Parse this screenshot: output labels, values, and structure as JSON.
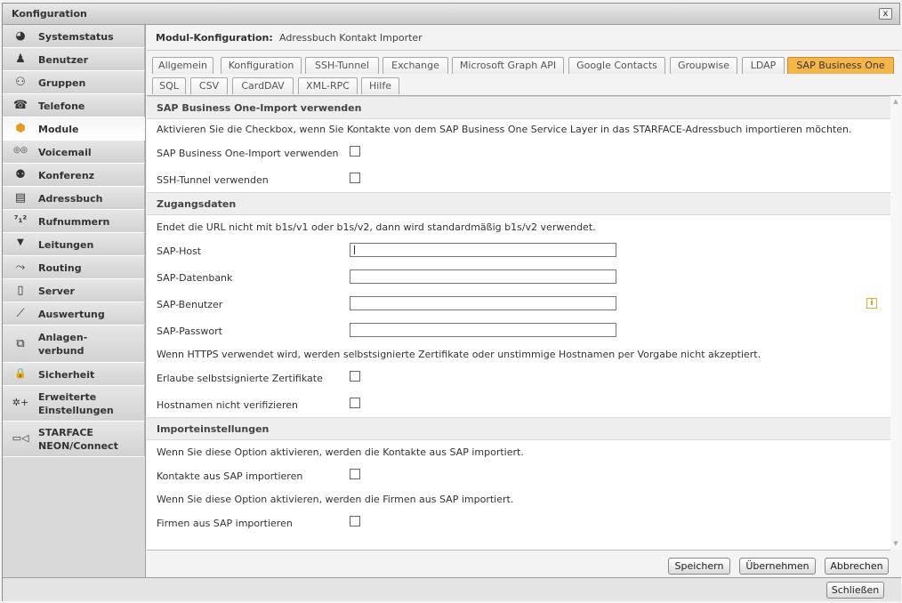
{
  "window": {
    "title": "Konfiguration",
    "close_glyph": "x"
  },
  "sidebar": {
    "items": [
      {
        "label": "Systemstatus",
        "icon": "◕",
        "name": "systemstatus"
      },
      {
        "label": "Benutzer",
        "icon": "♟",
        "name": "benutzer"
      },
      {
        "label": "Gruppen",
        "icon": "⚇",
        "name": "gruppen"
      },
      {
        "label": "Telefone",
        "icon": "☎",
        "name": "telefone"
      },
      {
        "label": "Module",
        "icon": "⬢",
        "name": "module"
      },
      {
        "label": "Voicemail",
        "icon": "◎◎",
        "name": "voicemail"
      },
      {
        "label": "Konferenz",
        "icon": "⚉",
        "name": "konferenz"
      },
      {
        "label": "Adressbuch",
        "icon": "▤",
        "name": "adressbuch"
      },
      {
        "label": "Rufnummern",
        "icon": "⁷₁²",
        "name": "rufnummern"
      },
      {
        "label": "Leitungen",
        "icon": "▼",
        "name": "leitungen"
      },
      {
        "label": "Routing",
        "icon": "⤳",
        "name": "routing"
      },
      {
        "label": "Server",
        "icon": "▯",
        "name": "server"
      },
      {
        "label": "Auswertung",
        "icon": "⟋",
        "name": "auswertung"
      },
      {
        "label": "Anlagen-\nverbund",
        "icon": "⧉",
        "name": "anlagenverbund"
      },
      {
        "label": "Sicherheit",
        "icon": "🔒",
        "name": "sicherheit"
      },
      {
        "label": "Erweiterte\nEinstellungen",
        "icon": "✲+",
        "name": "erweiterte-einstellungen"
      },
      {
        "label": "STARFACE\nNEON/Connect",
        "icon": "▭◁",
        "name": "starface-neon-connect"
      }
    ],
    "active": "Module"
  },
  "header": {
    "label": "Modul-Konfiguration:",
    "module_name": "Adressbuch Kontakt Importer"
  },
  "tabs_row1": [
    "Allgemein",
    "Konfiguration",
    "SSH-Tunnel",
    "Exchange",
    "Microsoft Graph API",
    "Google Contacts",
    "Groupwise",
    "LDAP",
    "SAP Business One"
  ],
  "tabs_row2": [
    "SQL",
    "CSV",
    "CardDAV",
    "XML-RPC",
    "Hilfe"
  ],
  "active_tab": "SAP Business One",
  "content": {
    "sec1_title": "SAP Business One-Import verwenden",
    "sec1_desc": "Aktivieren Sie die Checkbox, wenn Sie Kontakte von dem SAP Business One Service Layer in das STARFACE-Adressbuch importieren möchten.",
    "use_import_label": "SAP Business One-Import verwenden",
    "use_ssh_label": "SSH-Tunnel verwenden",
    "sec2_title": "Zugangsdaten",
    "sec2_desc": "Endet die URL nicht mit b1s/v1 oder b1s/v2, dann wird standardmäßig b1s/v2 verwendet.",
    "sap_host_label": "SAP-Host",
    "sap_host_value": "",
    "sap_db_label": "SAP-Datenbank",
    "sap_db_value": "",
    "sap_user_label": "SAP-Benutzer",
    "sap_user_value": "",
    "sap_pass_label": "SAP-Passwort",
    "sap_pass_value": "",
    "info_glyph": "i",
    "https_desc": "Wenn HTTPS verwendet wird, werden selbstsignierte Zertifikate oder unstimmige Hostnamen per Vorgabe nicht akzeptiert.",
    "allow_selfsigned_label": "Erlaube selbstsignierte Zertifikate",
    "no_verify_hostname_label": "Hostnamen nicht verifizieren",
    "sec3_title": "Importeinstellungen",
    "contacts_desc": "Wenn Sie diese Option aktivieren, werden die Kontakte aus SAP importiert.",
    "import_contacts_label": "Kontakte aus SAP importieren",
    "companies_desc": "Wenn Sie diese Option aktivieren, werden die Firmen aus SAP importiert.",
    "import_companies_label": "Firmen aus SAP importieren"
  },
  "buttons": {
    "save": "Speichern",
    "apply": "Übernehmen",
    "cancel": "Abbrechen",
    "close": "Schließen"
  },
  "colors": {
    "accent": "#f5b547",
    "active_tab_border": "#c88a2a"
  }
}
